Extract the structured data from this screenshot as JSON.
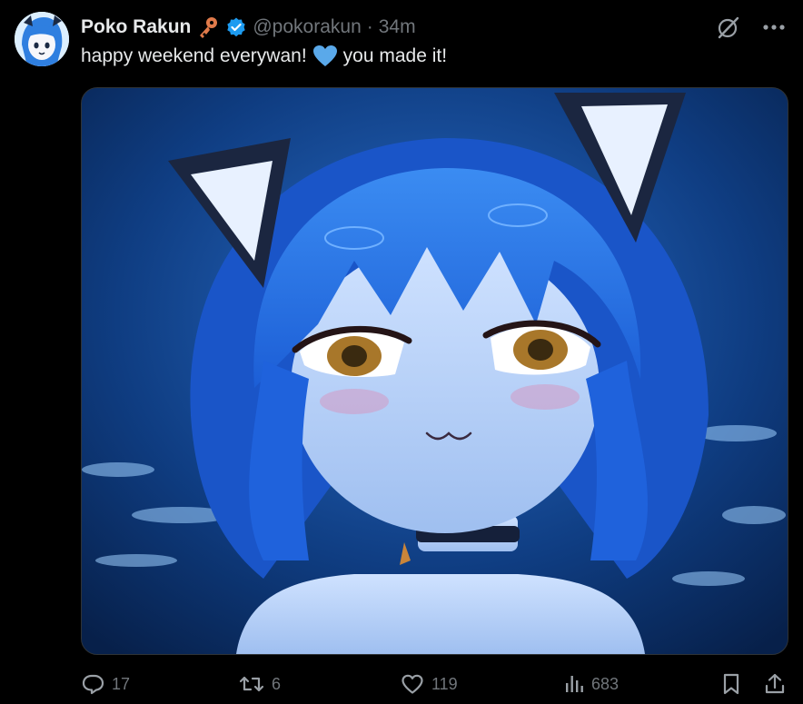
{
  "tweet": {
    "author_name": "Poko Rakun",
    "handle": "@pokorakun",
    "separator": "·",
    "time": "34m",
    "text_part1": "happy weekend everywan!",
    "text_part2": "you made it!",
    "emoji_name": "blue-heart-icon"
  },
  "actions": {
    "replies": "17",
    "reposts": "6",
    "likes": "119",
    "views": "683"
  },
  "colors": {
    "background": "#000000",
    "text_primary": "#e7e9ea",
    "text_secondary": "#71767b",
    "verified": "#1d9bf0",
    "heart": "#5aa9ea",
    "key": "#e07a4a"
  }
}
